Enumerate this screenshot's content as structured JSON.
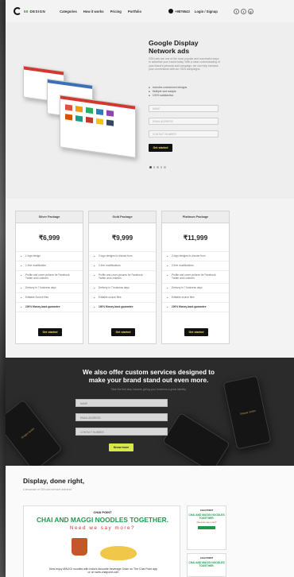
{
  "header": {
    "logo_prefix": "50",
    "logo_suffix": "DESIGN",
    "nav": [
      "Categories",
      "How it works",
      "Pricing",
      "Portfolio"
    ],
    "phone": "+9876543",
    "login": "Login / Signup",
    "socials": [
      "f",
      "t",
      "g"
    ]
  },
  "hero": {
    "title_line1": "Google Display",
    "title_line2": "Network ads",
    "description": "GDN ads are one of the most popular and successful ways to advertise your brand today. With a clear understanding of your brand's persona and campaign, we can help increase your conversions with our GDN campaigns.",
    "bullets": [
      "Includes customized designs",
      "Multiple size adapts",
      "100% satisfaction"
    ],
    "fields": [
      "NAME",
      "EMAIL ADDRESS",
      "CONTACT NUMBER"
    ],
    "cta": "Get started",
    "slides": 5,
    "active_slide": 0
  },
  "pricing": {
    "plans": [
      {
        "name": "Silver Package",
        "price": "₹6,999",
        "features": [
          "1 logo design",
          "1 free modification",
          "Profile and cover pictures for Facebook, Twitter and LinkedIn",
          "Delivery in 7 business days",
          "Editable Source files",
          "100% Money-back guarantee"
        ],
        "cta": "Get started"
      },
      {
        "name": "Gold Package",
        "price": "₹9,999",
        "features": [
          "2 logo designs to choose from",
          "2 free modifications",
          "Profile and cover pictures for Facebook, Twitter and LinkedIn",
          "Delivery in 7 business days",
          "Editable source files",
          "100% Money-back guarantee"
        ],
        "cta": "Get started"
      },
      {
        "name": "Platinum Package",
        "price": "₹11,999",
        "features": [
          "3 logo designs to choose from",
          "3 free modifications",
          "Profile and cover pictures for Facebook, Twitter and LinkedIn",
          "Delivery in 7 business days",
          "Editable source files",
          "100% Money-back guarantee"
        ],
        "cta": "Get started"
      }
    ]
  },
  "services": {
    "title_line1": "We also offer custom services designed to",
    "title_line2": "make your brand stand out even more.",
    "subtitle": "Take the first step towards giving your business a great identity.",
    "fields": [
      "NAME",
      "EMAIL ADDRESS",
      "CONTACT NUMBER"
    ],
    "cta": "Know more",
    "mock_brand": "Shoppe Jumbo"
  },
  "display": {
    "title": "Display, done right,",
    "subtitle": "A showcase of GDN ads we have delivered",
    "ad": {
      "brand": "CHAI POINT",
      "title": "CHAI AND MAGGI NOODLES TOGETHER.",
      "tagline": "Need we say more?",
      "footer": "Now enjoy MAGGI noodles with India's favourite beverage Order on The Chai Point app or on www.chaipoint.com"
    },
    "side_ad": {
      "brand": "CHAI POINT",
      "title": "CHAI AND MAGGI NOODLES TOGETHER.",
      "tagline": "Need we say more?"
    }
  },
  "colors": {
    "accent_green": "#1e9a4c",
    "button_dark": "#111111",
    "button_yellow_text": "#f5e24a",
    "services_bg": "#2b2b2b",
    "know_more": "#d7e84a"
  }
}
